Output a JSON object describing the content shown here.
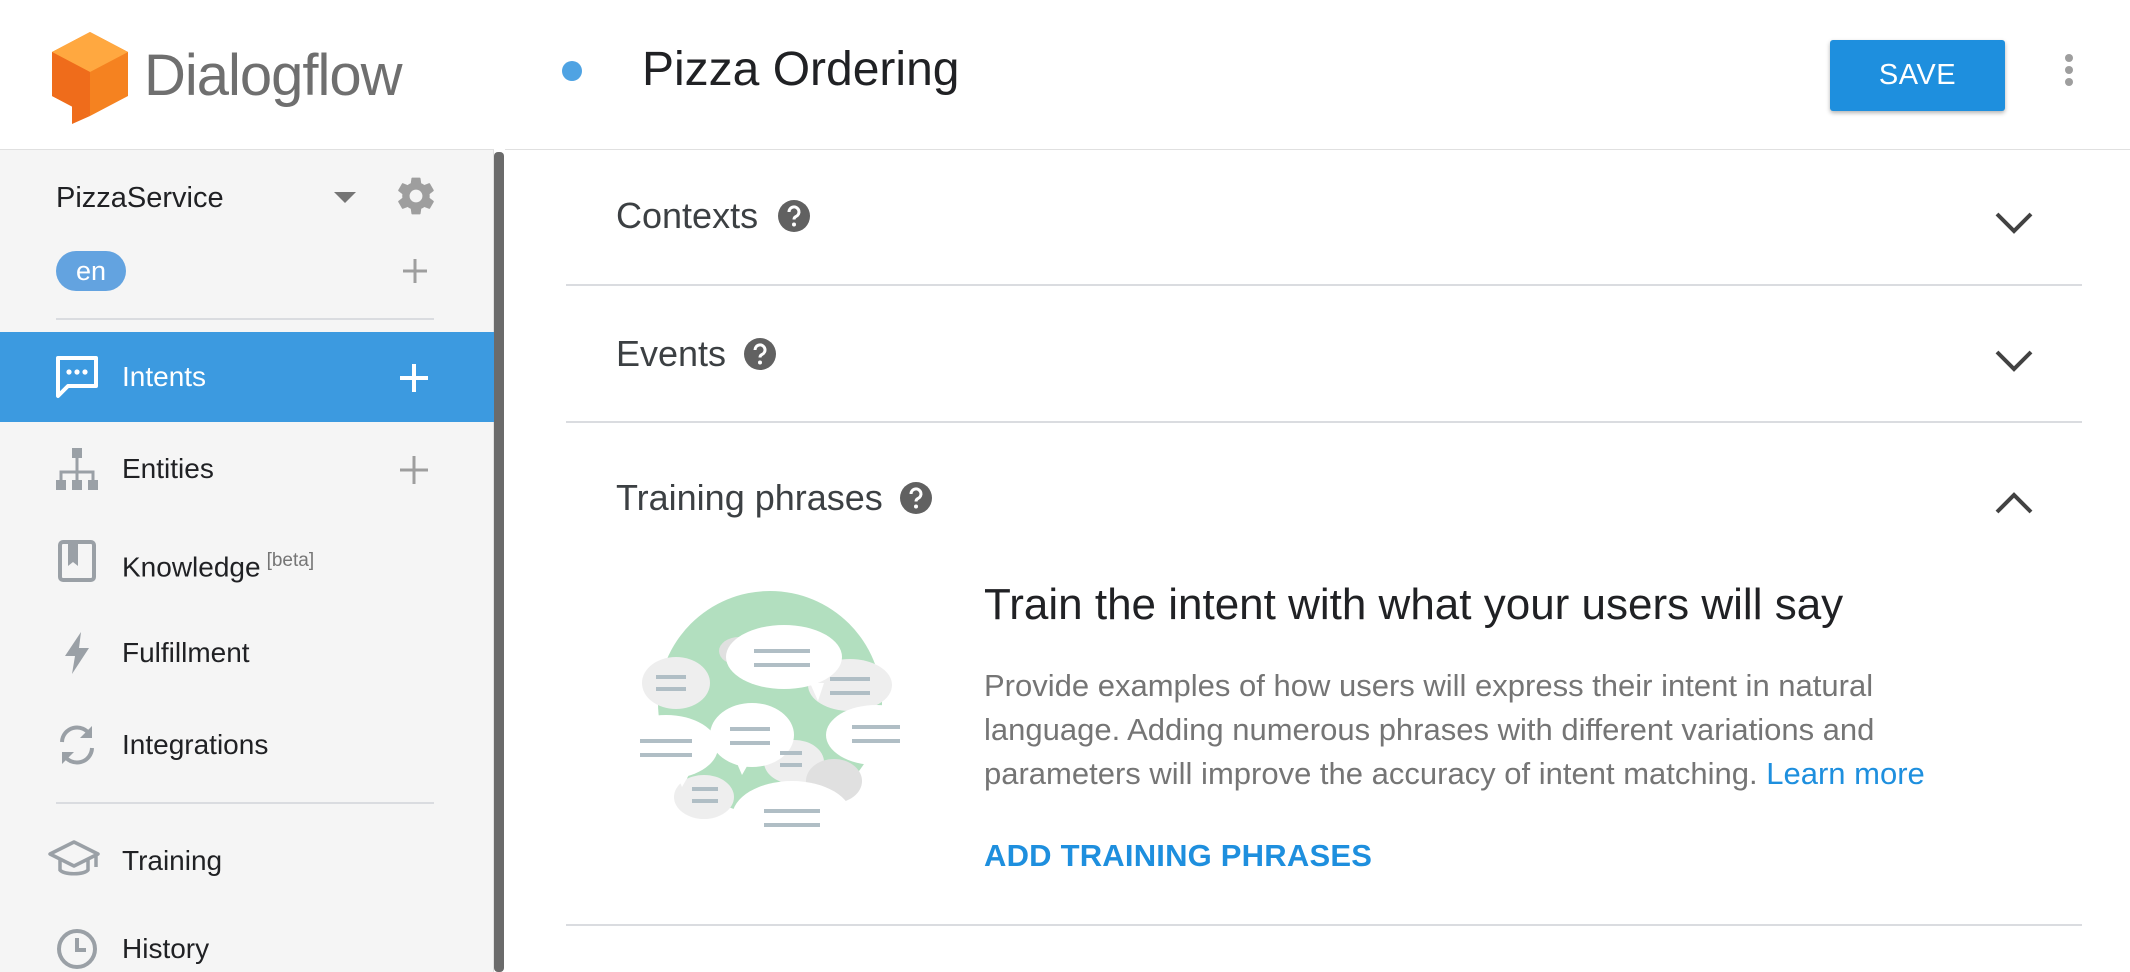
{
  "app": {
    "name": "Dialogflow",
    "brand_color": "#f58220",
    "accent_color": "#3c9ae0"
  },
  "sidebar": {
    "agent_name": "PizzaService",
    "language": "en",
    "items": [
      {
        "label": "Intents",
        "icon": "intents-icon",
        "active": true,
        "addable": true
      },
      {
        "label": "Entities",
        "icon": "entities-icon",
        "active": false,
        "addable": true
      },
      {
        "label": "Knowledge",
        "badge": "[beta]",
        "icon": "knowledge-icon",
        "active": false
      },
      {
        "label": "Fulfillment",
        "icon": "fulfillment-icon",
        "active": false
      },
      {
        "label": "Integrations",
        "icon": "integrations-icon",
        "active": false
      },
      {
        "label": "Training",
        "icon": "training-icon",
        "active": false
      },
      {
        "label": "History",
        "icon": "history-icon",
        "active": false
      }
    ]
  },
  "header": {
    "intent_name": "Pizza Ordering",
    "save_label": "SAVE"
  },
  "sections": [
    {
      "title": "Contexts",
      "expanded": false
    },
    {
      "title": "Events",
      "expanded": false
    },
    {
      "title": "Training phrases",
      "expanded": true
    }
  ],
  "training_empty": {
    "title": "Train the intent with what your users will say",
    "description": "Provide examples of how users will express their intent in natural language. Adding numerous phrases with different variations and parameters will improve the accuracy of intent matching.",
    "learn_more": "Learn more",
    "action": "ADD TRAINING PHRASES"
  }
}
